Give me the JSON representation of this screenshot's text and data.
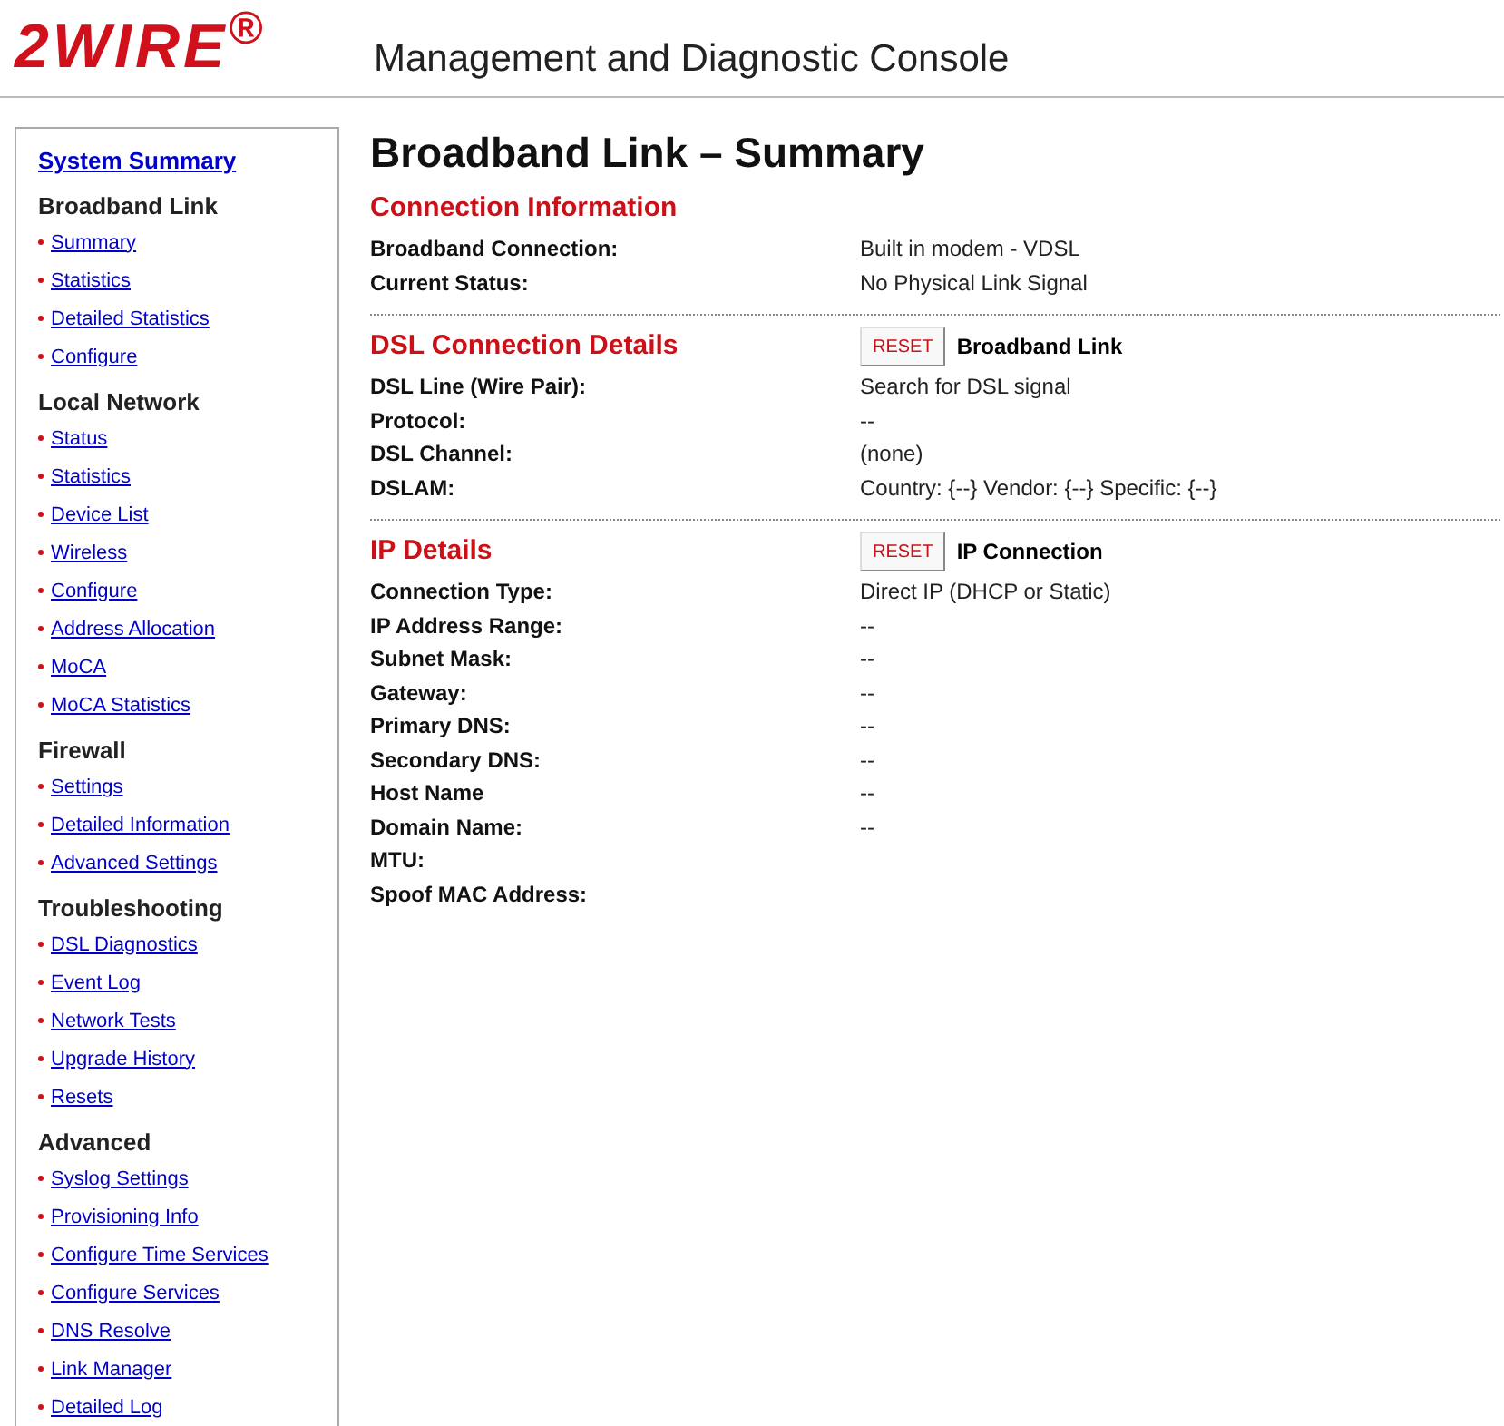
{
  "header": {
    "logo": "2WIRE$^{®}$",
    "title": "Management and Diagnostic Console"
  },
  "sidebar": {
    "top_link": "System Summary",
    "groups": [
      {
        "heading": "Broadband Link",
        "items": [
          "Summary",
          "Statistics",
          "Detailed Statistics",
          "Configure"
        ]
      },
      {
        "heading": "Local Network",
        "items": [
          "Status",
          "Statistics",
          "Device List",
          "Wireless",
          "Configure",
          "Address Allocation",
          "MoCA",
          "MoCA Statistics"
        ]
      },
      {
        "heading": "Firewall",
        "items": [
          "Settings",
          "Detailed Information",
          "Advanced Settings"
        ]
      },
      {
        "heading": "Troubleshooting",
        "items": [
          "DSL Diagnostics",
          "Event Log",
          "Network Tests",
          "Upgrade History",
          "Resets"
        ]
      },
      {
        "heading": "Advanced",
        "items": [
          "Syslog Settings",
          "Provisioning Info",
          "Configure Time Services",
          "Configure Services",
          "DNS Resolve",
          "Link Manager",
          "Detailed Log"
        ]
      }
    ]
  },
  "page_title": "Broadband Link – Summary",
  "sections": [
    {
      "title": "Connection Information",
      "rows": [
        {
          "label": "Broadband Connection:",
          "value": "Built in modem - VDSL"
        },
        {
          "label": "Current Status:",
          "value": "No Physical Link Signal"
        }
      ]
    },
    {
      "title": "DSL Connection Details",
      "reset_button": "RESET",
      "reset_label": "Broadband Link",
      "rows": [
        {
          "label": "DSL Line (Wire Pair):",
          "value": "Search for DSL signal"
        },
        {
          "label": "Protocol:",
          "value": "--"
        },
        {
          "label": "DSL Channel:",
          "value": "(none)"
        },
        {
          "label": "DSLAM:",
          "value": "Country: {--} Vendor: {--} Specific: {--}"
        }
      ]
    },
    {
      "title": "IP Details",
      "reset_button": "RESET",
      "reset_label": "IP Connection",
      "rows": [
        {
          "label": "Connection Type:",
          "value": "Direct IP (DHCP or Static)"
        },
        {
          "label": "IP Address Range:",
          "value": "--"
        },
        {
          "label": "Subnet Mask:",
          "value": "--"
        },
        {
          "label": "Gateway:",
          "value": "--"
        },
        {
          "label": "Primary DNS:",
          "value": "--"
        },
        {
          "label": "Secondary DNS:",
          "value": "--"
        },
        {
          "label": "Host Name",
          "value": "--"
        },
        {
          "label": "Domain Name:",
          "value": "--"
        },
        {
          "label": "MTU:"
        },
        {
          "label": "Spoof MAC Address:"
        }
      ]
    }
  ]
}
